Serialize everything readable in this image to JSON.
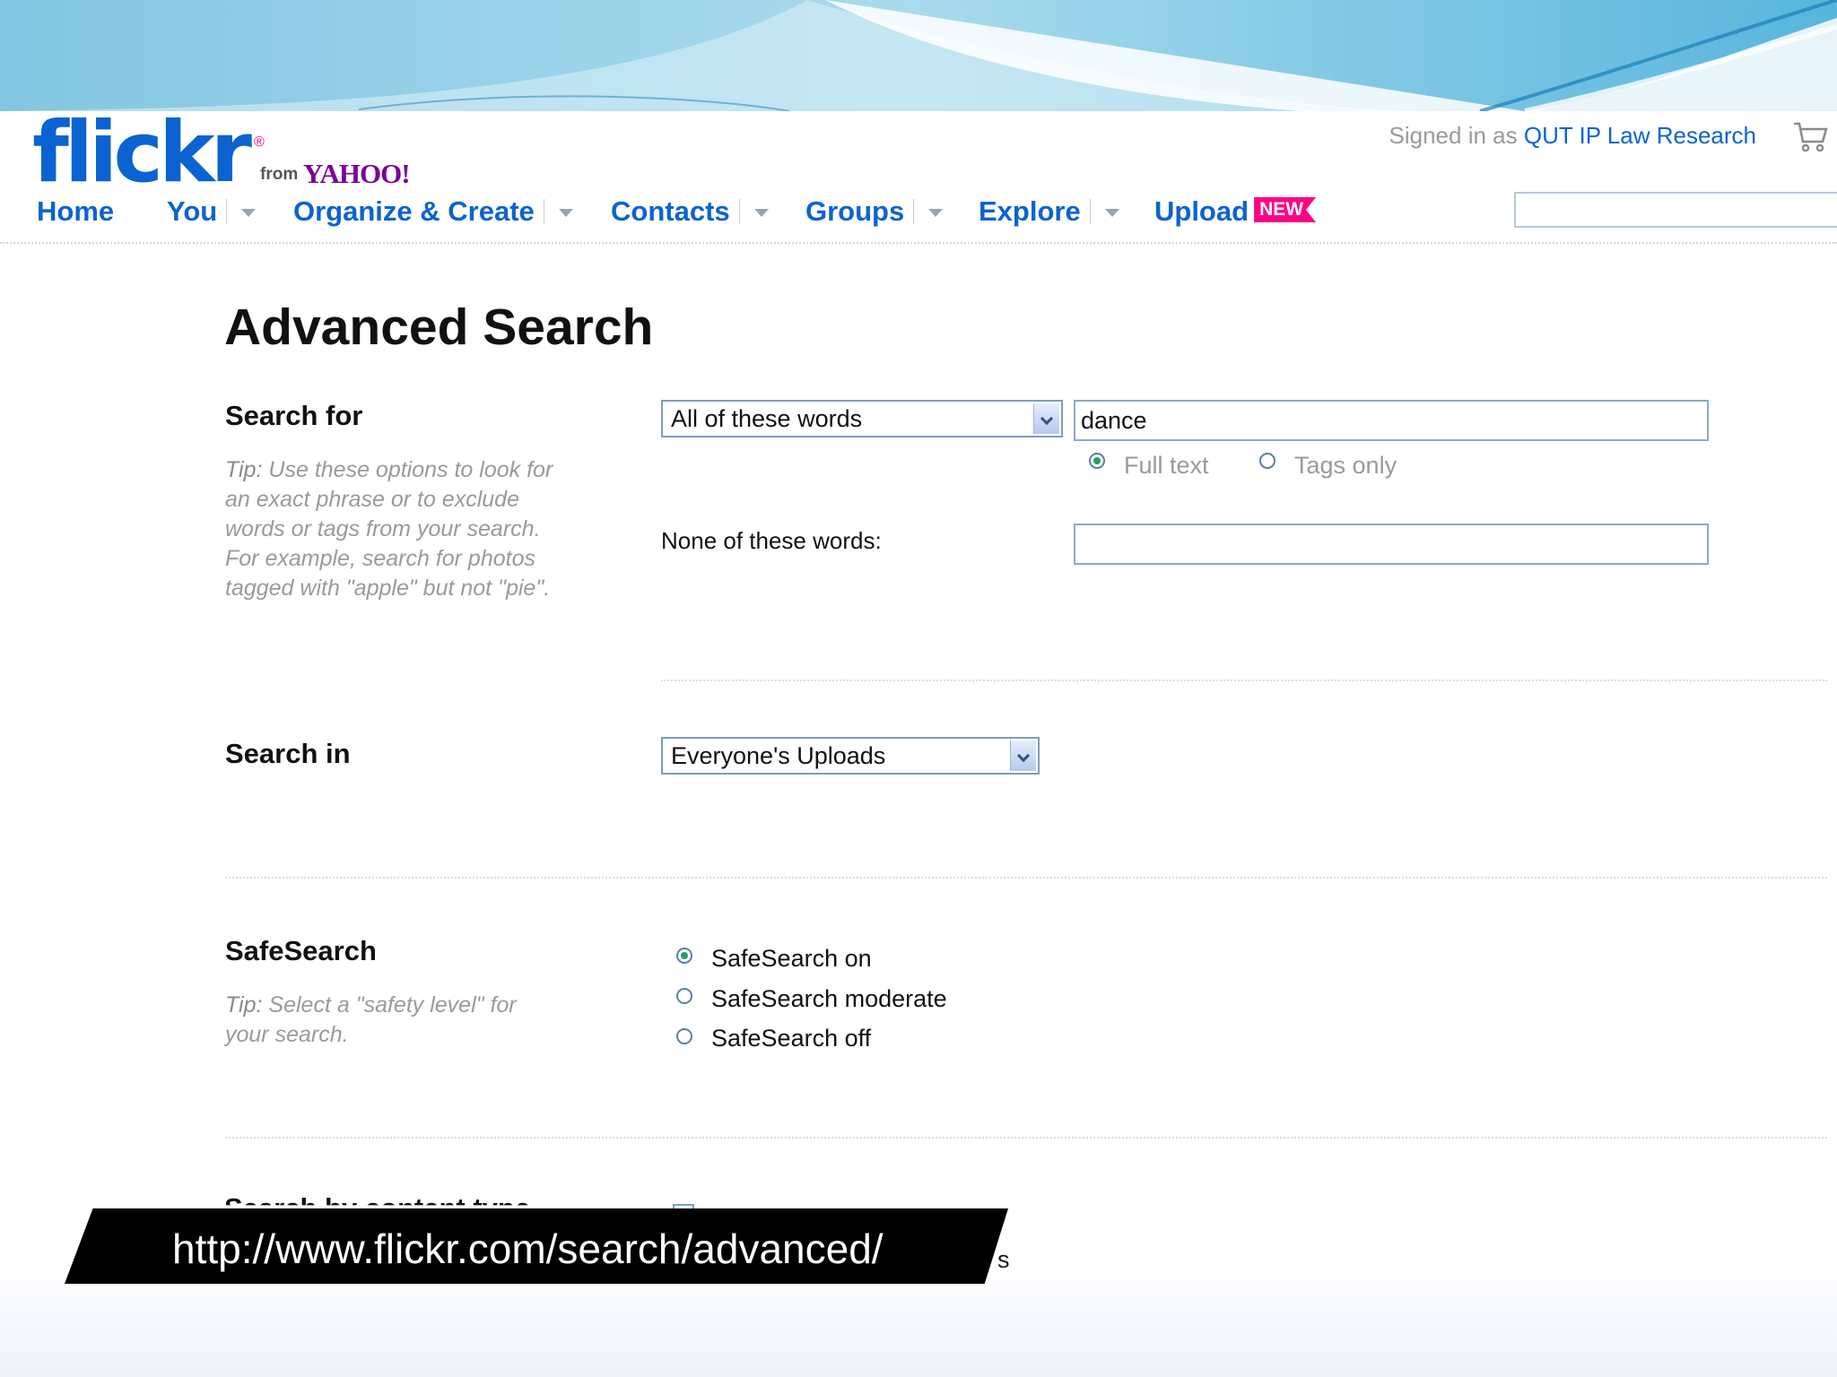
{
  "header": {
    "logo": {
      "wordmark": "flickr",
      "registered": "®",
      "from": "from",
      "brand": "YAHOO!"
    },
    "signed_in": {
      "prefix": "Signed in as ",
      "user": "QUT IP Law Research"
    },
    "search": {
      "value": ""
    }
  },
  "nav": {
    "items": [
      {
        "label": "Home"
      },
      {
        "label": "You"
      },
      {
        "label": "Organize & Create"
      },
      {
        "label": "Contacts"
      },
      {
        "label": "Groups"
      },
      {
        "label": "Explore"
      },
      {
        "label": "Upload",
        "badge": "NEW"
      }
    ]
  },
  "page": {
    "title": "Advanced Search"
  },
  "search_for": {
    "label": "Search for",
    "tip_lead": "Tip:",
    "tip_text": "Use these options to look for an exact phrase or to exclude words or tags from your search. For example, search for photos tagged with \"apple\" but not \"pie\".",
    "mode_select": "All of these words",
    "query_value": "dance",
    "scope_options": [
      {
        "label": "Full text",
        "checked": true
      },
      {
        "label": "Tags only",
        "checked": false
      }
    ],
    "none_label": "None of these words:",
    "none_value": ""
  },
  "search_in": {
    "label": "Search in",
    "select": "Everyone's Uploads"
  },
  "safesearch": {
    "label": "SafeSearch",
    "tip_lead": "Tip:",
    "tip_text": "Select a \"safety level\" for your search.",
    "options": [
      {
        "label": "SafeSearch on",
        "checked": true
      },
      {
        "label": "SafeSearch moderate",
        "checked": false
      },
      {
        "label": "SafeSearch off",
        "checked": false
      }
    ]
  },
  "content_type": {
    "label": "Search by content type",
    "trailing": "s"
  },
  "caption": {
    "url": "http://www.flickr.com/search/advanced/"
  },
  "colors": {
    "link_blue": "#0b63d1",
    "brand_pink": "#ff0084",
    "yahoo_purple": "#7b0099"
  }
}
